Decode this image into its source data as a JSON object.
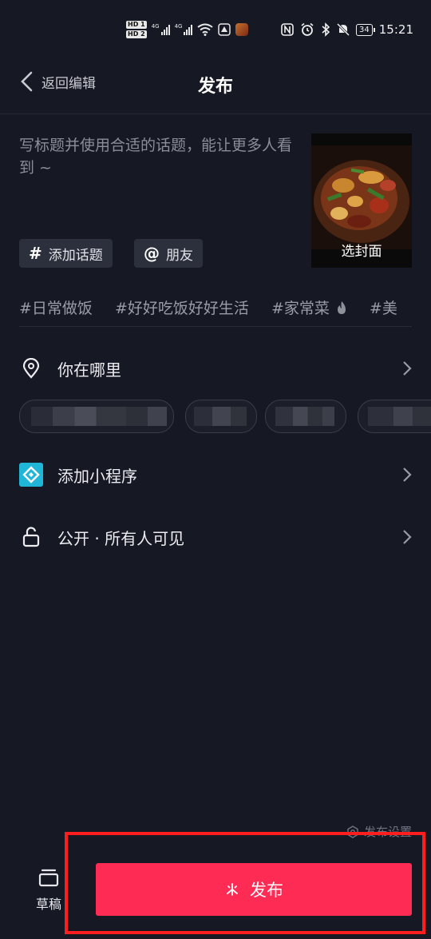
{
  "status_bar": {
    "hd_labels": [
      "HD 1",
      "HD 2"
    ],
    "net_labels": [
      "4G",
      "4G"
    ],
    "time": "15:21",
    "battery": "34"
  },
  "header": {
    "back_label": "返回编辑",
    "title": "发布"
  },
  "composer": {
    "caption_placeholder": "写标题并使用合适的话题，能让更多人看到 ~",
    "cover_label": "选封面",
    "chips": [
      {
        "symbol": "#",
        "label": "添加话题"
      },
      {
        "symbol": "@",
        "label": "朋友"
      }
    ]
  },
  "suggested_tags": [
    "#日常做饭",
    "#好好吃饭好好生活",
    "#家常菜",
    "#美"
  ],
  "options": {
    "location_label": "你在哪里",
    "mini_program_label": "添加小程序",
    "visibility_label": "公开 · 所有人可见"
  },
  "footer": {
    "settings_label": "发布设置",
    "drafts_label": "草稿",
    "publish_label": "发布"
  },
  "colors": {
    "background": "#161824",
    "publish_button": "#fe2c55",
    "highlight_box": "#ff1e1e",
    "mini_program_icon": "#1fb6d8"
  }
}
